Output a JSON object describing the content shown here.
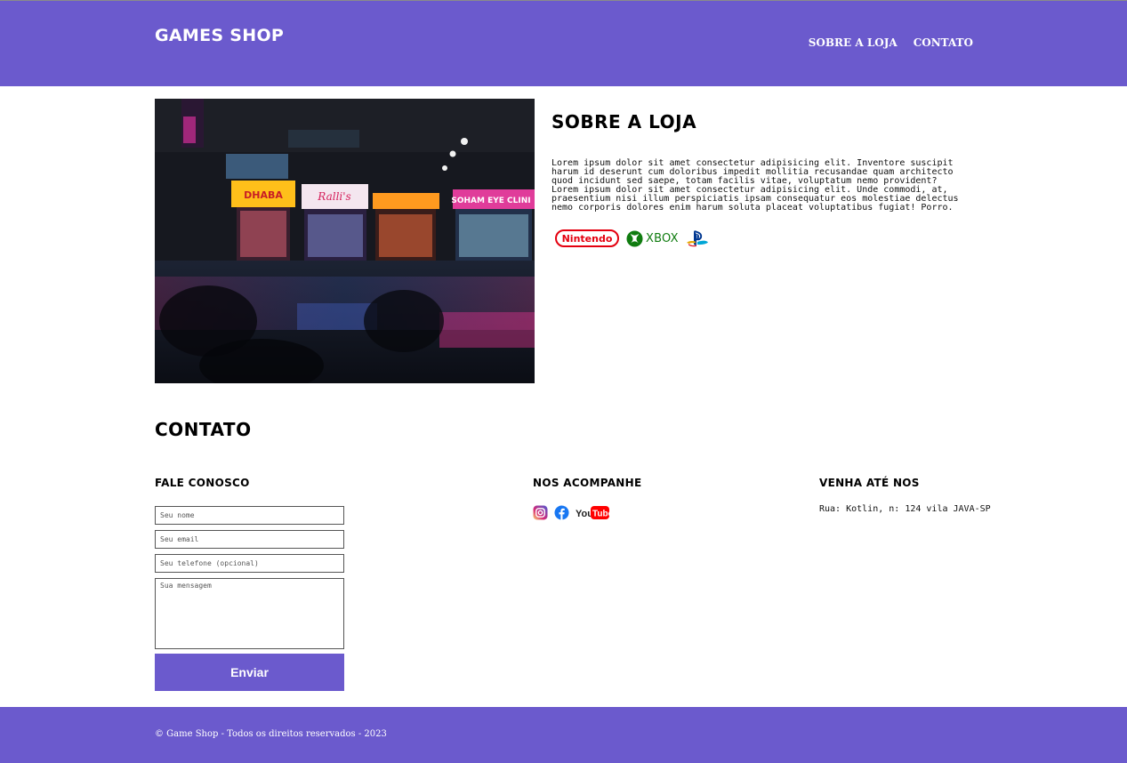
{
  "header": {
    "logo": "GAMES SHOP",
    "nav": [
      "SOBRE A LOJA",
      "CONTATO"
    ]
  },
  "about": {
    "title": "SOBRE A LOJA",
    "paragraphs": [
      "Lorem ipsum dolor sit amet consectetur adipisicing elit. Inventore suscipit harum id deserunt cum doloribus impedit mollitia recusandae quam architecto quod incidunt sed saepe, totam facilis vitae, voluptatum nemo provident?",
      "Lorem ipsum dolor sit amet consectetur adipisicing elit. Unde commodi, at, praesentium nisi illum perspiciatis ipsam consequatur eos molestiae delectus nemo corporis dolores enim harum soluta placeat voluptatibus fugiat! Porro."
    ],
    "brands": {
      "nintendo": "Nintendo",
      "xbox": "XBOX",
      "playstation": "playstation-logo"
    }
  },
  "contact": {
    "title": "CONTATO",
    "form": {
      "heading": "FALE CONOSCO",
      "name_placeholder": "Seu nome",
      "email_placeholder": "Seu email",
      "phone_placeholder": "Seu telefone (opcional)",
      "message_placeholder": "Sua mensagem",
      "submit": "Enviar"
    },
    "social": {
      "heading": "NOS ACOMPANHE",
      "icons": [
        "instagram-icon",
        "facebook-icon",
        "youtube-icon"
      ],
      "youtube_you": "You",
      "youtube_tube": "Tube"
    },
    "location": {
      "heading": "VENHA ATÉ NOS",
      "address": "Rua: Kotlin, n: 124 vila JAVA-SP"
    }
  },
  "footer": {
    "text": "© Game Shop - Todos os direitos reservados - 2023"
  },
  "colors": {
    "primary": "#6b5acd",
    "nintendo_red": "#e4000f",
    "xbox_green": "#107c10",
    "facebook_blue": "#1877f2",
    "youtube_red": "#ff0000"
  }
}
